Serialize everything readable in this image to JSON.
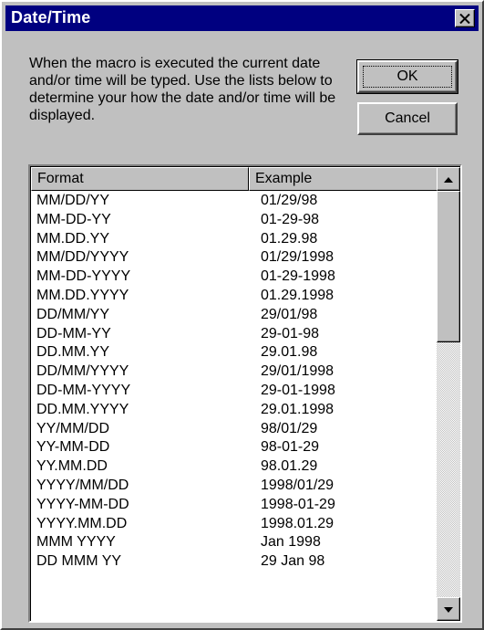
{
  "window": {
    "title": "Date/Time"
  },
  "description": "When the macro is executed the current date and/or time will be typed.  Use the lists below to determine your how the date and/or time will be displayed.",
  "buttons": {
    "ok": "OK",
    "cancel": "Cancel"
  },
  "list": {
    "columns": [
      "Format",
      "Example"
    ],
    "rows": [
      [
        "MM/DD/YY",
        "01/29/98"
      ],
      [
        "MM-DD-YY",
        "01-29-98"
      ],
      [
        "MM.DD.YY",
        "01.29.98"
      ],
      [
        "MM/DD/YYYY",
        "01/29/1998"
      ],
      [
        "MM-DD-YYYY",
        "01-29-1998"
      ],
      [
        "MM.DD.YYYY",
        "01.29.1998"
      ],
      [
        "DD/MM/YY",
        "29/01/98"
      ],
      [
        "DD-MM-YY",
        "29-01-98"
      ],
      [
        "DD.MM.YY",
        "29.01.98"
      ],
      [
        "DD/MM/YYYY",
        "29/01/1998"
      ],
      [
        "DD-MM-YYYY",
        "29-01-1998"
      ],
      [
        "DD.MM.YYYY",
        "29.01.1998"
      ],
      [
        "YY/MM/DD",
        "98/01/29"
      ],
      [
        "YY-MM-DD",
        "98-01-29"
      ],
      [
        "YY.MM.DD",
        "98.01.29"
      ],
      [
        "YYYY/MM/DD",
        "1998/01/29"
      ],
      [
        "YYYY-MM-DD",
        "1998-01-29"
      ],
      [
        "YYYY.MM.DD",
        "1998.01.29"
      ],
      [
        "MMM YYYY",
        "Jan 1998"
      ],
      [
        "DD MMM YY",
        "29 Jan 98"
      ]
    ]
  },
  "icons": {
    "close": "close-icon",
    "scroll_up": "arrow-up-icon",
    "scroll_down": "arrow-down-icon"
  }
}
